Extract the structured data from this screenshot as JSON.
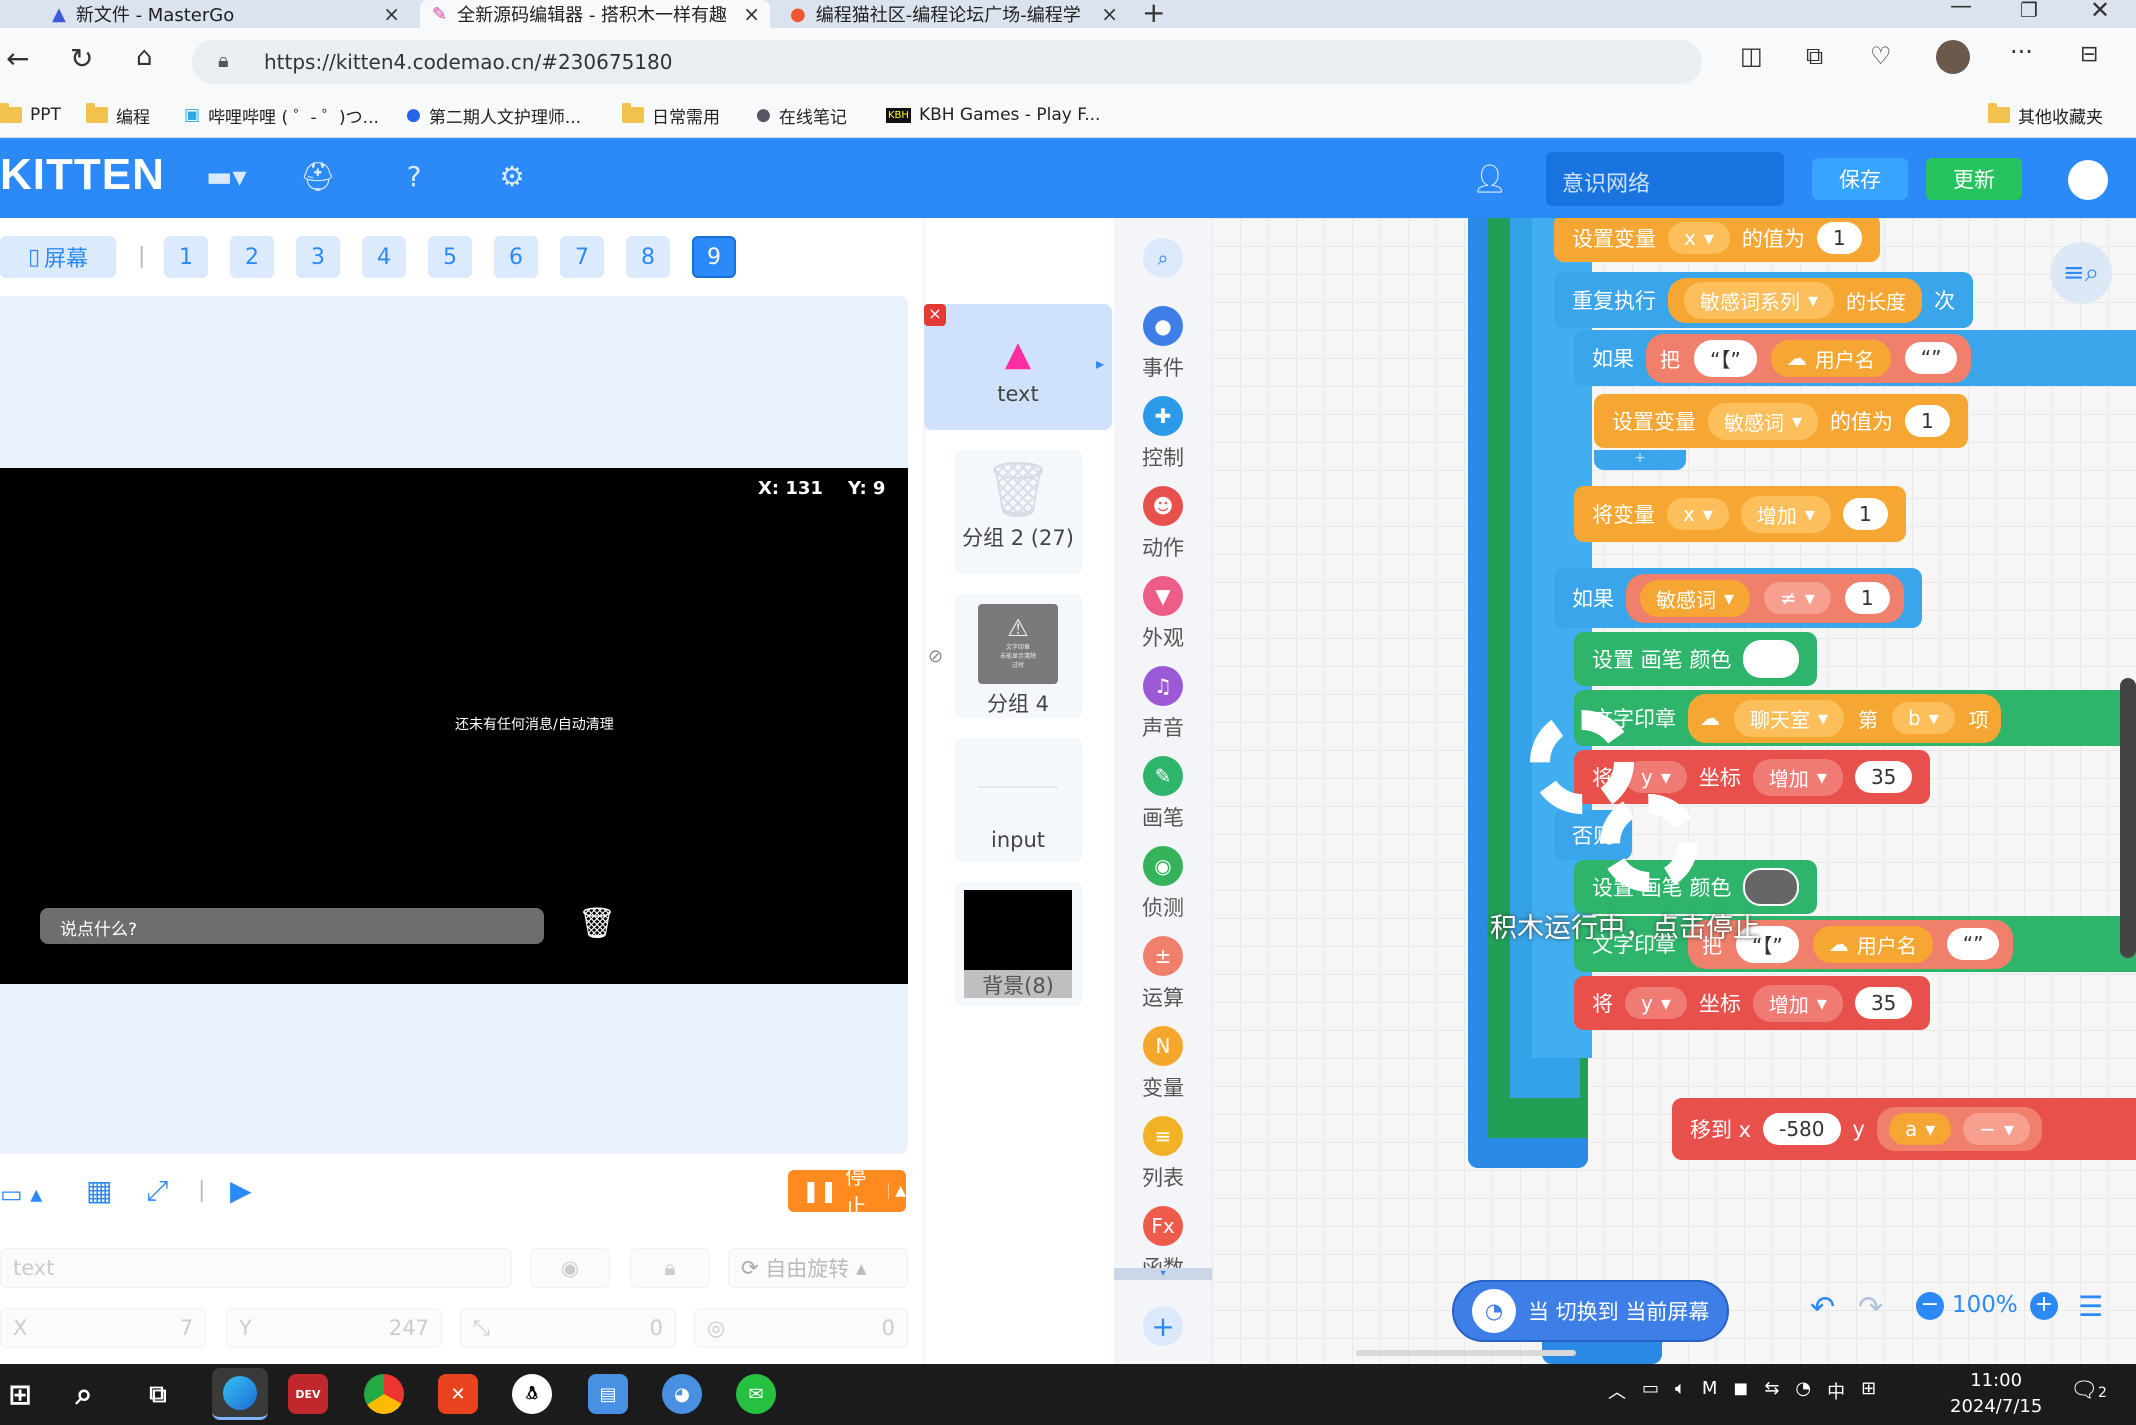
{
  "browser": {
    "tabs": [
      {
        "title": "新文件 - MasterGo"
      },
      {
        "title": "全新源码编辑器 - 搭积木一样有趣"
      },
      {
        "title": "编程猫社区-编程论坛广场-编程学"
      }
    ],
    "url": "https://kitten4.codemao.cn/#230675180",
    "bookmarks": [
      "PPT",
      "编程",
      "哔哩哔哩 ( ゜- ゜)つ...",
      "第二期人文护理师...",
      "日常需用",
      "在线笔记",
      "KBH Games - Play F..."
    ],
    "other_bookmarks": "其他收藏夹"
  },
  "app": {
    "logo": "KITTEN",
    "project_name": "意识网络",
    "save_label": "保存",
    "update_label": "更新"
  },
  "screens": {
    "screen_label": "屏幕",
    "pages": [
      "1",
      "2",
      "3",
      "4",
      "5",
      "6",
      "7",
      "8",
      "9"
    ],
    "active": "9",
    "add_label": "+"
  },
  "stage": {
    "coords": "X: 131    Y: 9",
    "empty_message": "还未有任何消息/自动清理",
    "chat_placeholder": "说点什么?",
    "stop_label": "停止"
  },
  "props": {
    "name": "text",
    "rotation_label": "自由旋转",
    "x_label": "X",
    "x_value": "7",
    "y_label": "Y",
    "y_value": "247",
    "size_value": "0",
    "dir_value": "0"
  },
  "sprites": [
    {
      "name": "text"
    },
    {
      "name": "分组 2 (27)"
    },
    {
      "name": "分组 4"
    },
    {
      "name": "input"
    },
    {
      "name": "背景(8)"
    }
  ],
  "warn_thumb": {
    "line1": "文字印章",
    "line2": "未能显示清除",
    "line3": "过时"
  },
  "categories": [
    {
      "label": "事件",
      "color": "#3d7fe6"
    },
    {
      "label": "控制",
      "color": "#2b9ae8"
    },
    {
      "label": "动作",
      "color": "#e8514b"
    },
    {
      "label": "外观",
      "color": "#ee5c8a"
    },
    {
      "label": "声音",
      "color": "#9b59d6"
    },
    {
      "label": "画笔",
      "color": "#2fb46c"
    },
    {
      "label": "侦测",
      "color": "#34b35a"
    },
    {
      "label": "运算",
      "color": "#f0806b"
    },
    {
      "label": "变量",
      "color": "#f4a72a"
    },
    {
      "label": "列表",
      "color": "#f2b225"
    },
    {
      "label": "函数",
      "color": "#ef5b4a"
    }
  ],
  "blocks": {
    "set_x": {
      "label": "设置变量",
      "var": "x",
      "mid": "的值为",
      "val": "1"
    },
    "repeat": {
      "label": "重复执行",
      "var": "敏感词系列",
      "mid": "的长度",
      "end": "次"
    },
    "if1": {
      "label": "如果",
      "op": "把",
      "q1": "“【”",
      "var": "用户名",
      "q2": "“”"
    },
    "set_sens": {
      "label": "设置变量",
      "var": "敏感词",
      "mid": "的值为",
      "val": "1"
    },
    "inc_x": {
      "label": "将变量",
      "var": "x",
      "mid": "增加",
      "val": "1"
    },
    "if2": {
      "label": "如果",
      "var": "敏感词",
      "op": "≠",
      "val": "1"
    },
    "pen_color": {
      "label": "设置 画笔 颜色"
    },
    "stamp": {
      "label": "文字印章",
      "var": "聊天室",
      "nth": "第",
      "b": "b",
      "end": "项"
    },
    "ycoord1": {
      "pre": "将",
      "var": "y",
      "mid": "坐标",
      "op": "增加",
      "val": "35"
    },
    "else": {
      "label": "否则"
    },
    "pen_color2": {
      "label": "设置 画笔 颜色"
    },
    "stamp2": {
      "label": "文字印章",
      "op": "把",
      "q1": "“【”",
      "var": "用户名",
      "q2": "“”"
    },
    "ycoord2": {
      "pre": "将",
      "var": "y",
      "mid": "坐标",
      "op": "增加",
      "val": "35"
    },
    "moveto": {
      "label": "移到 x",
      "x": "-580",
      "y": "y",
      "var": "a",
      "op": "−"
    },
    "running": "积木运行中，点击停止",
    "event": "当 切换到 当前屏幕",
    "zoom": "100%"
  },
  "taskbar": {
    "time": "11:00",
    "date": "2024/7/15",
    "ime": "中",
    "notif": "2"
  }
}
